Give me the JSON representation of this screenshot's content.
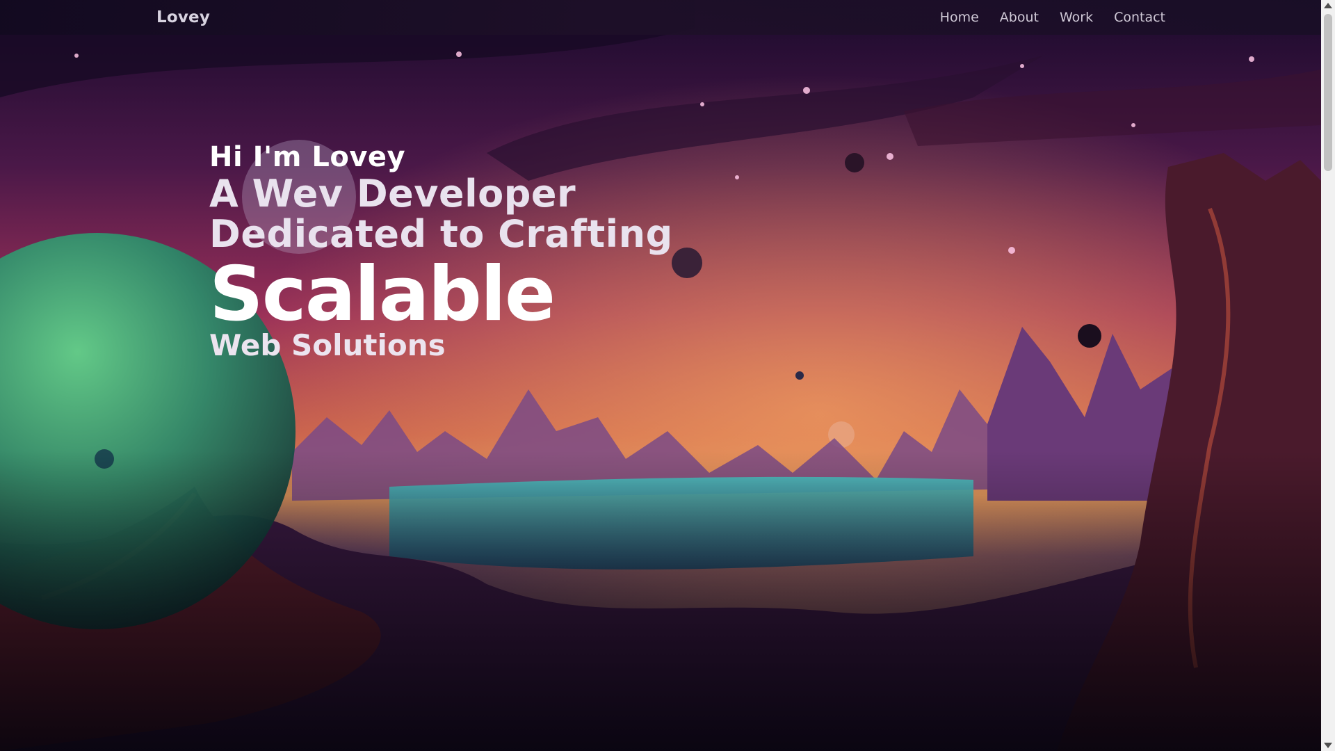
{
  "header": {
    "brand": "Lovey",
    "nav": [
      "Home",
      "About",
      "Work",
      "Contact"
    ]
  },
  "hero": {
    "greeting": "Hi I'm Lovey",
    "line1": "A Wev Developer",
    "line2": "Dedicated to Crafting",
    "highlight": "Scalable",
    "line3": "Web Solutions"
  },
  "scene": {
    "background": "alien-planet-landscape",
    "colors": {
      "sky_top": "#2a0f3e",
      "sky_mid": "#8b2a5a",
      "horizon": "#d87a4a",
      "planet": "#2e8a6a",
      "water": "#3fb0b0"
    }
  },
  "scrollbar": {
    "position_fraction": 0.0
  }
}
